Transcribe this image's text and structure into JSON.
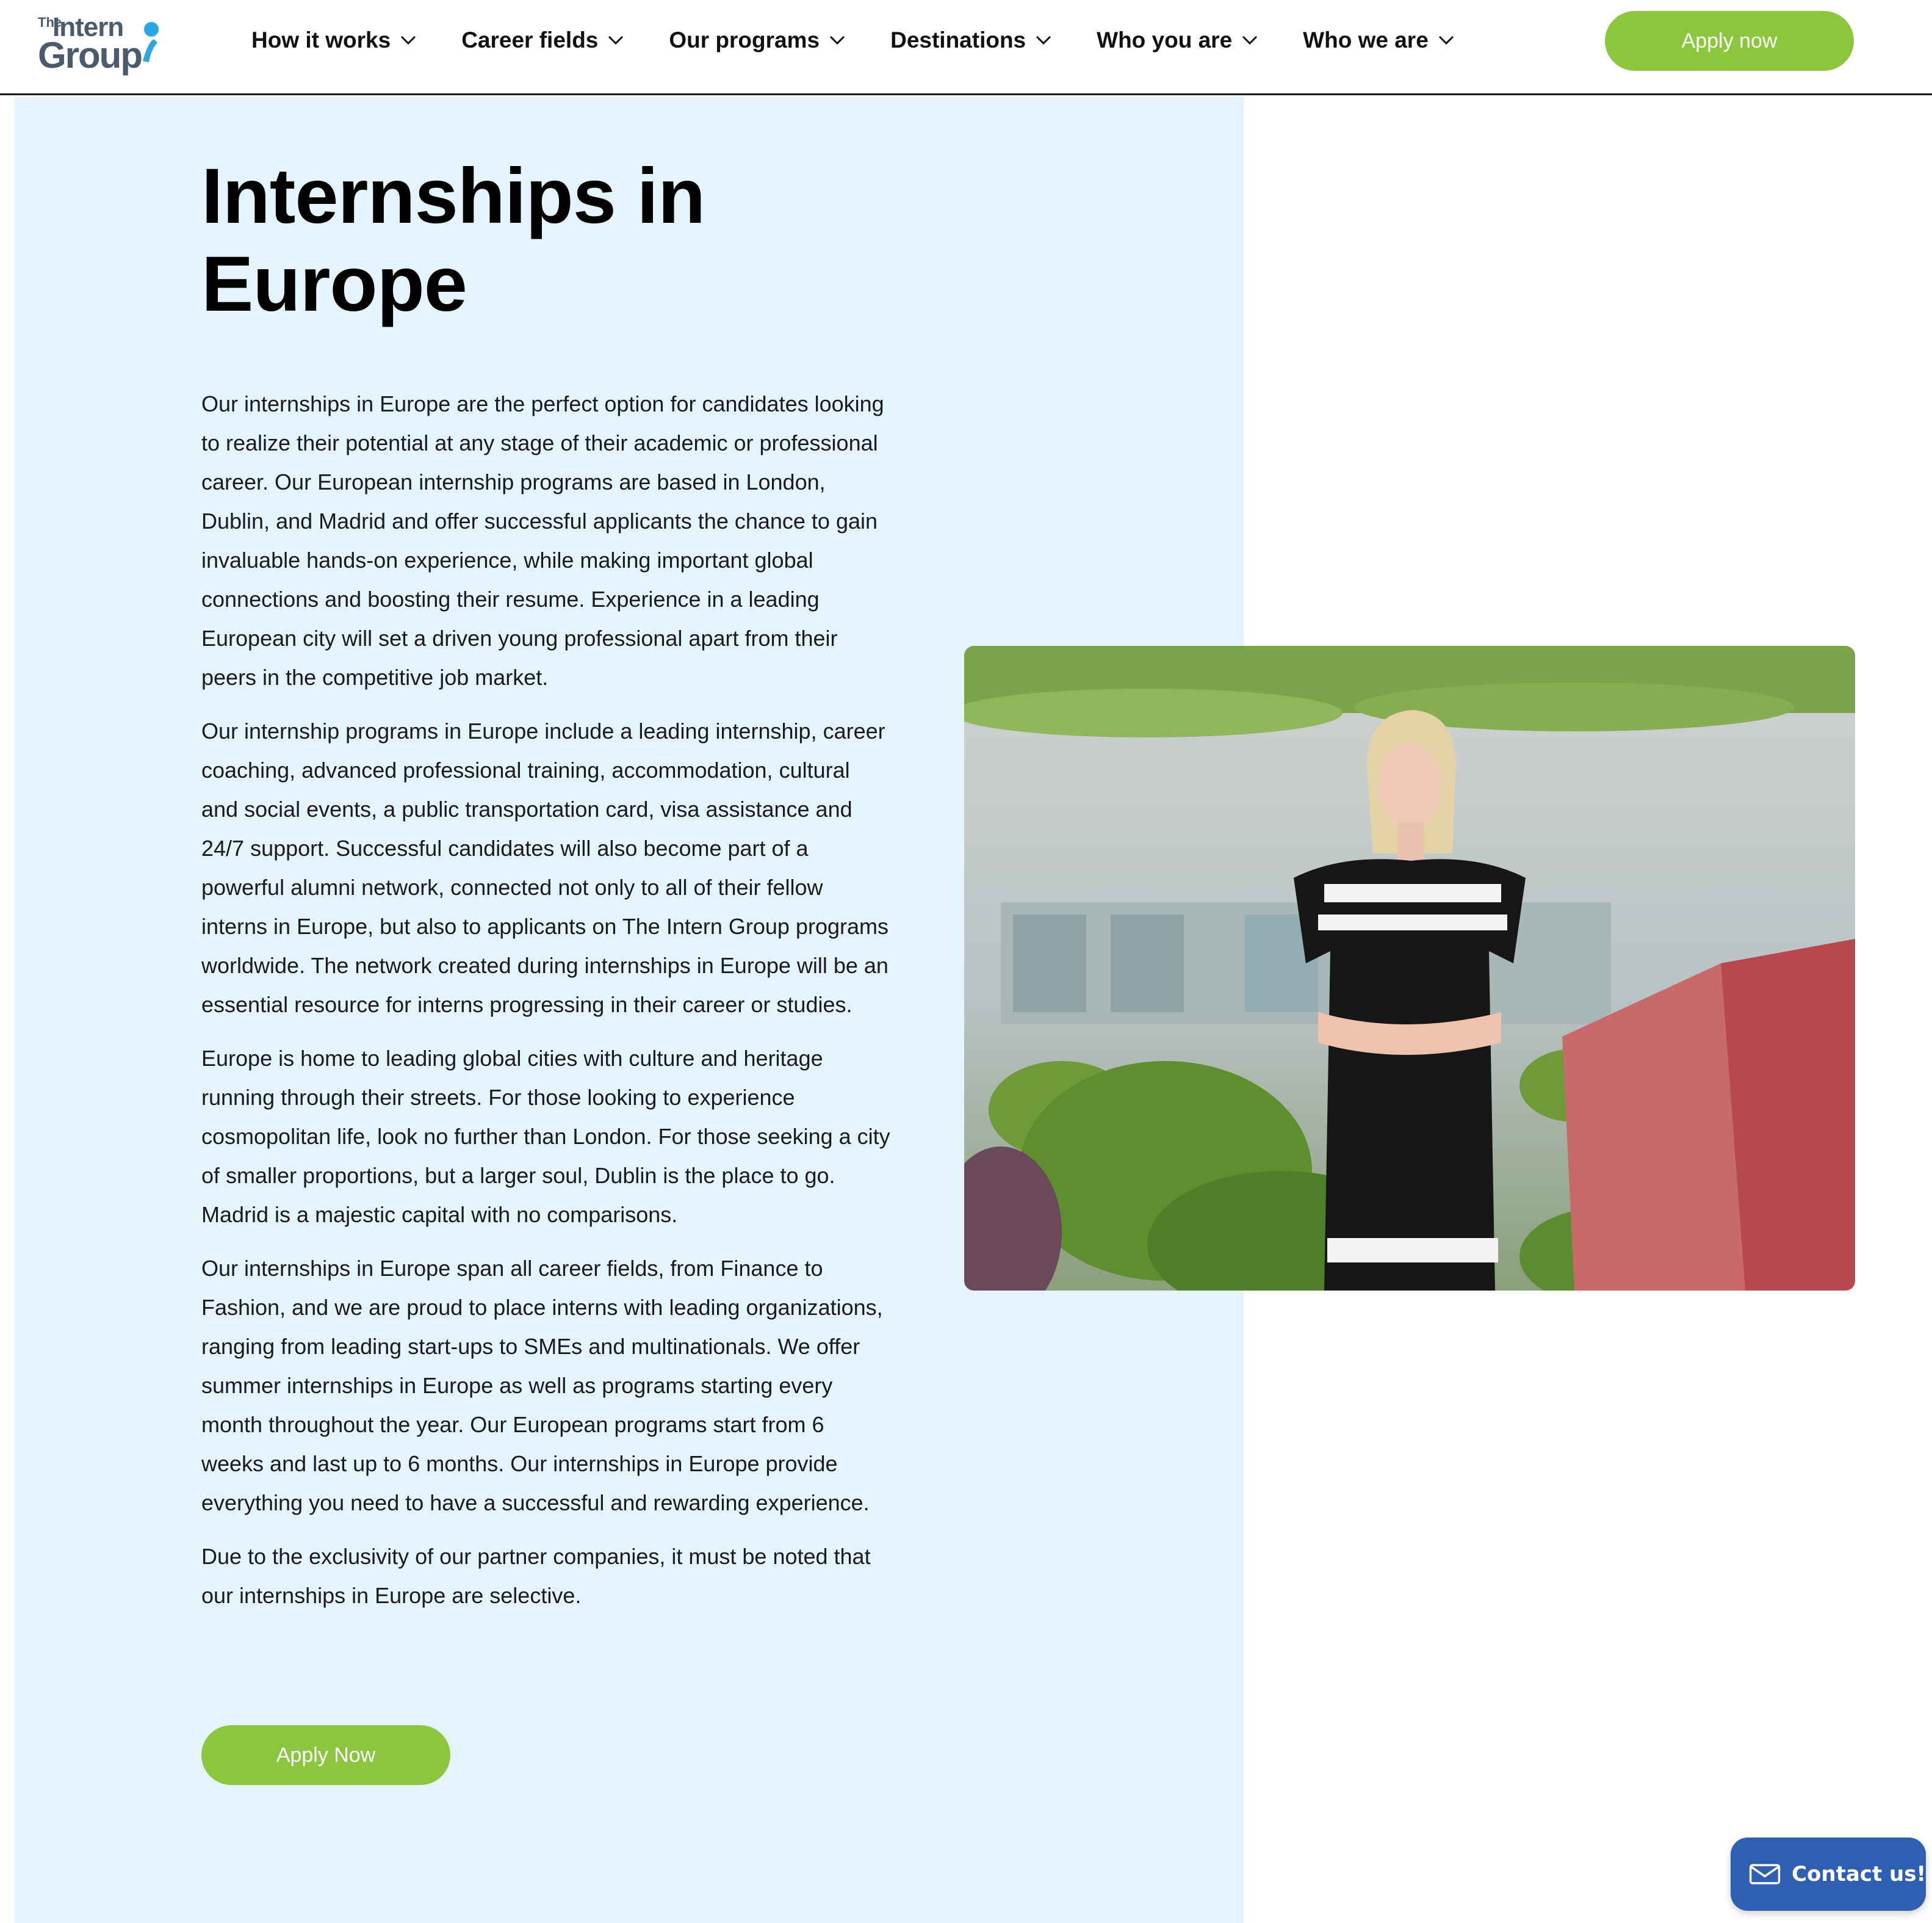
{
  "header": {
    "logo": {
      "small": "The",
      "top": "Intern",
      "bottom": "Group"
    },
    "nav": [
      {
        "label": "How it works"
      },
      {
        "label": "Career fields"
      },
      {
        "label": "Our programs"
      },
      {
        "label": "Destinations"
      },
      {
        "label": "Who you are"
      },
      {
        "label": "Who we are"
      }
    ],
    "apply_label": "Apply now"
  },
  "colors": {
    "accent_green": "#8cc63f",
    "panel_bg": "#e3f4fc",
    "contact_blue": "#2f5fb3"
  },
  "hero": {
    "title_line1": "Internships in",
    "title_line2": "Europe",
    "paragraphs": [
      "Our internships in Europe are the perfect option for candidates looking to realize their potential at any stage of their academic or professional career. Our European internship programs are based in London, Dublin, and Madrid and offer successful applicants the chance to gain invaluable hands-on experience, while making important global connections and boosting their resume. Experience in a leading European city will set a driven young professional apart from their peers in the competitive job market.",
      "Our internship programs in Europe include a leading internship, career coaching, advanced professional training, accommodation, cultural and social events, a public transportation card, visa assistance and 24/7 support. Successful candidates will also become part of a powerful alumni network, connected not only to all of their fellow interns in Europe, but also to applicants on The Intern Group programs worldwide. The network created during internships in Europe will be an essential resource for interns progressing in their career or studies.",
      "Europe is home to leading global cities with culture and heritage running through their streets. For those looking to experience cosmopolitan life, look no further than London. For those seeking a city of smaller proportions, but a larger soul, Dublin is the place to go. Madrid is a majestic capital with no comparisons.",
      "Our internships in Europe span all career fields, from Finance to Fashion, and we are proud to place interns with leading organizations, ranging from leading start-ups to SMEs and multinationals. We offer summer internships in Europe as well as programs starting every month throughout the year. Our European programs start from 6 weeks and last up to 6 months. Our internships in Europe provide everything you need to have a successful and rewarding experience.",
      "Due to the exclusivity of our partner companies, it must be noted that our internships in Europe are selective."
    ],
    "apply_label": "Apply Now"
  },
  "contact": {
    "label": "Contact us!",
    "icon": "mail-icon"
  }
}
